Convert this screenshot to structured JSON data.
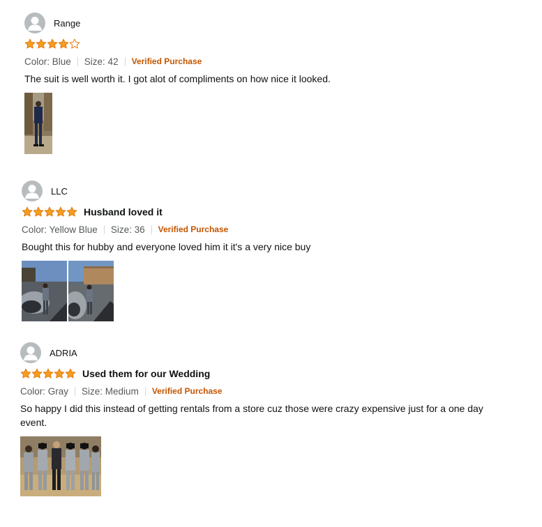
{
  "reviews": [
    {
      "author": "Range",
      "rating": 4,
      "max_rating": 5,
      "title": "",
      "color_label": "Color: Blue",
      "size_label": "Size: 42",
      "verified_label": "Verified Purchase",
      "body": "The suit is well worth it. I got alot of compliments on how nice it looked.",
      "photos": [
        {
          "subject": "man in dark blue suit standing outdoors"
        }
      ]
    },
    {
      "author": "LLC",
      "rating": 5,
      "max_rating": 5,
      "title": "Husband loved it",
      "color_label": "Color: Yellow Blue",
      "size_label": "Size: 36",
      "verified_label": "Verified Purchase",
      "body": "Bought this for hubby and everyone loved him it it's a very nice buy",
      "photos": [
        {
          "subject": "man in suit in parking lot by car"
        },
        {
          "subject": "man in suit in parking lot by building"
        }
      ]
    },
    {
      "author": "ADRIA",
      "rating": 5,
      "max_rating": 5,
      "title": "Used them for our Wedding",
      "color_label": "Color: Gray",
      "size_label": "Size: Medium",
      "verified_label": "Verified Purchase",
      "body": "So happy I did this instead of getting rentals from a store cuz those were crazy expensive just for a one day event.",
      "photos": [
        {
          "subject": "wedding party group in gray suits"
        }
      ]
    }
  ],
  "colors": {
    "star_fill": "#f49e1e",
    "star_stroke": "#e47911",
    "verified": "#c45500",
    "meta_text": "#565959",
    "avatar": "#b7bcbf"
  },
  "icons": {
    "avatar": "user-silhouette-icon",
    "star_full": "star-filled-icon",
    "star_empty": "star-empty-icon"
  }
}
